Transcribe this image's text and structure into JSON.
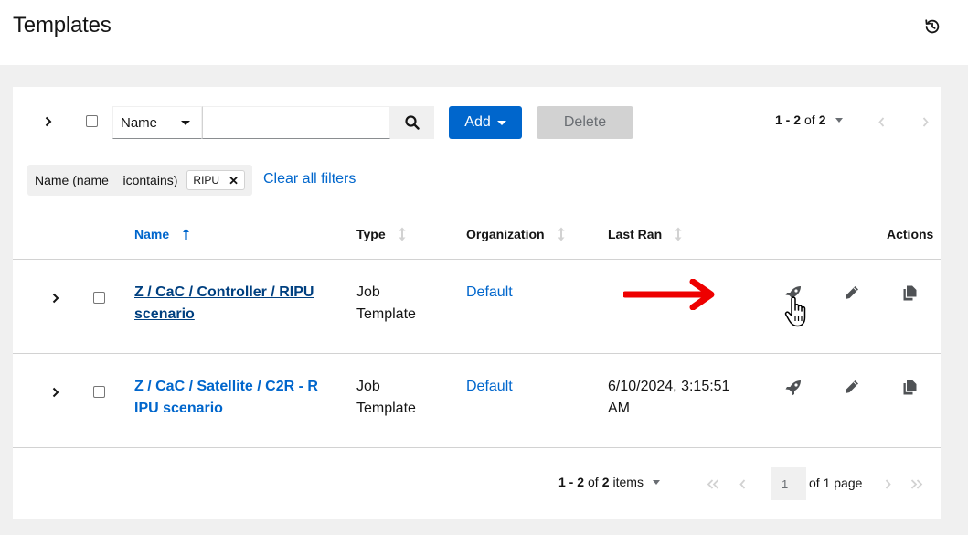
{
  "header": {
    "title": "Templates",
    "history_icon": "history-icon"
  },
  "toolbar": {
    "filter_field": "Name",
    "search_value": "",
    "add_label": "Add",
    "delete_label": "Delete",
    "pagination": {
      "range": "1 - 2",
      "of_word": "of",
      "total": "2"
    }
  },
  "filters": {
    "category": "Name (name__icontains)",
    "chips": [
      "RIPU"
    ],
    "clear_label": "Clear all filters"
  },
  "table": {
    "columns": {
      "name": "Name",
      "type": "Type",
      "organization": "Organization",
      "last_ran": "Last Ran",
      "actions": "Actions"
    },
    "rows": [
      {
        "name_line1": "Z / CaC / Controller / RIPU",
        "name_line2": "scenario",
        "type_line1": "Job",
        "type_line2": "Template",
        "organization": "Default",
        "last_ran_line1": "",
        "last_ran_line2": ""
      },
      {
        "name_line1": "Z / CaC / Satellite / C2R - R",
        "name_line2": "IPU scenario",
        "type_line1": "Job",
        "type_line2": "Template",
        "organization": "Default",
        "last_ran_line1": "6/10/2024, 3:15:51",
        "last_ran_line2": "AM"
      }
    ]
  },
  "footer": {
    "range": "1 - 2",
    "of_word": "of",
    "total": "2",
    "items_word": "items",
    "page_value": "1",
    "of_page": "of 1 page"
  },
  "colors": {
    "primary": "#0066cc",
    "annotation_arrow": "#ee0000"
  }
}
